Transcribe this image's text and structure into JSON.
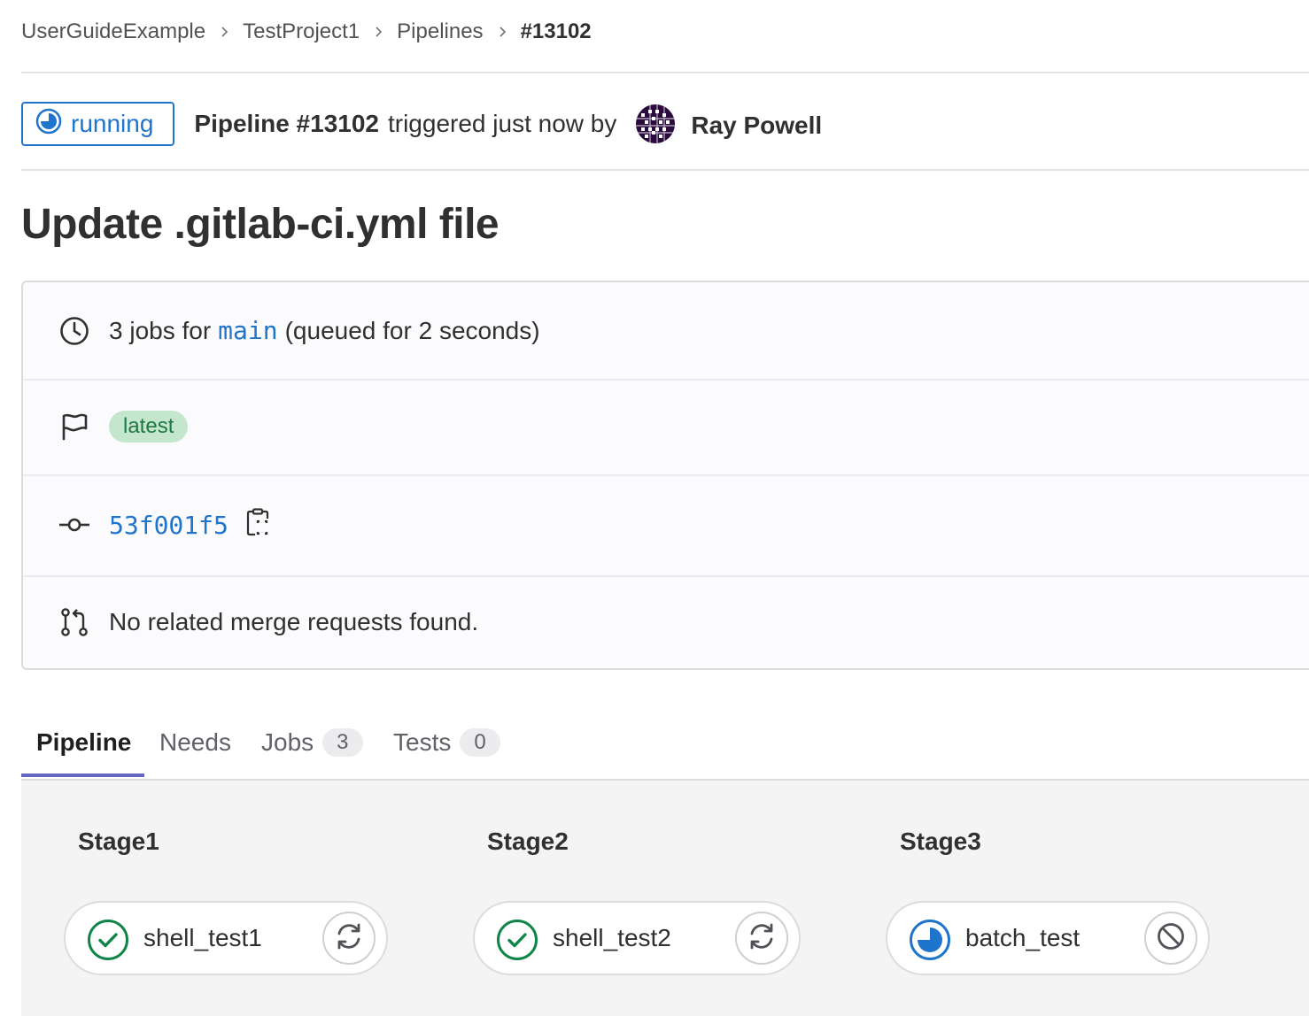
{
  "breadcrumb": {
    "items": [
      "UserGuideExample",
      "TestProject1",
      "Pipelines",
      "#13102"
    ]
  },
  "header": {
    "status_label": "running",
    "pipeline_id": "Pipeline #13102",
    "triggered_text": "triggered just now by",
    "user_name": "Ray Powell"
  },
  "commit_title": "Update .gitlab-ci.yml file",
  "info": {
    "jobs_prefix": "3 jobs for",
    "branch": "main",
    "queued": "(queued for 2 seconds)",
    "tag": "latest",
    "sha": "53f001f5",
    "merge_requests": "No related merge requests found."
  },
  "tabs": [
    {
      "label": "Pipeline",
      "count": null,
      "active": true
    },
    {
      "label": "Needs",
      "count": null,
      "active": false
    },
    {
      "label": "Jobs",
      "count": "3",
      "active": false
    },
    {
      "label": "Tests",
      "count": "0",
      "active": false
    }
  ],
  "stages": [
    {
      "title": "Stage1",
      "job": "shell_test1",
      "status": "success",
      "action": "retry-icon"
    },
    {
      "title": "Stage2",
      "job": "shell_test2",
      "status": "success",
      "action": "retry-icon"
    },
    {
      "title": "Stage3",
      "job": "batch_test",
      "status": "running",
      "action": "cancel-icon"
    }
  ],
  "colors": {
    "running_blue": "#1f75cb",
    "success_green": "#108548",
    "tab_underline": "#6666c4"
  }
}
